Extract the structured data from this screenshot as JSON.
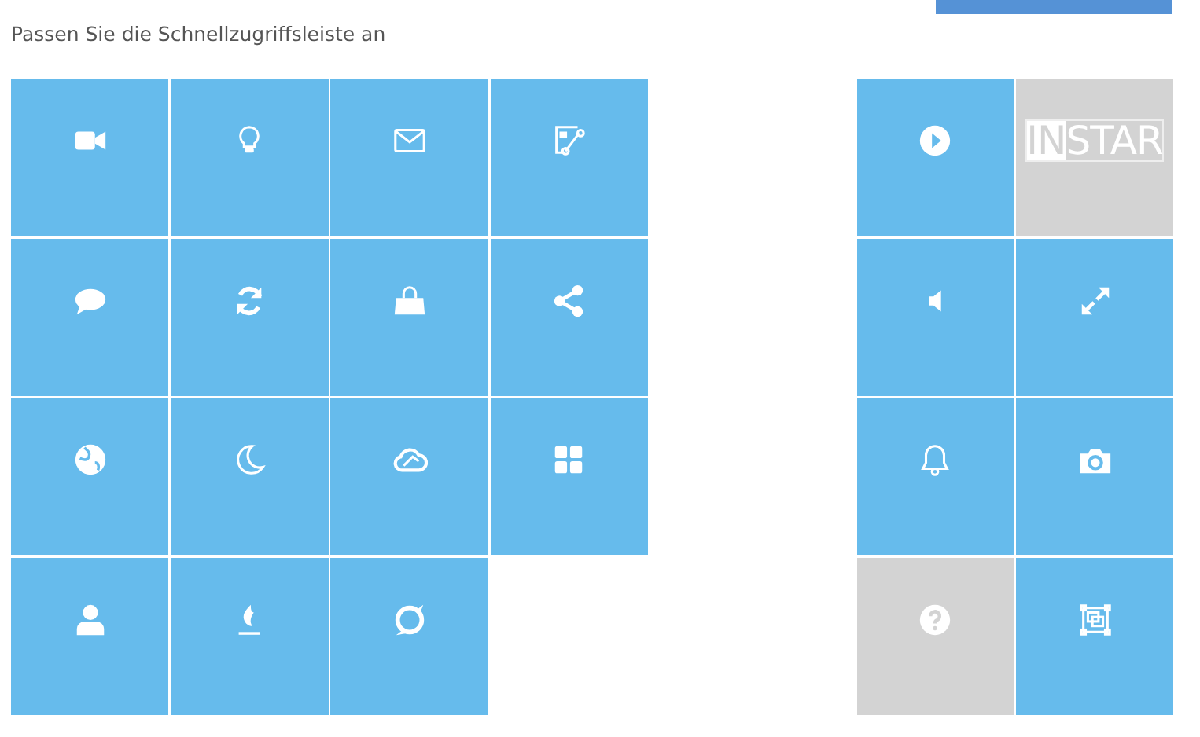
{
  "heading": "Passen Sie die Schnellzugriffsleiste an",
  "left_tiles": [
    {
      "disabled": false
    },
    {
      "disabled": false
    },
    {
      "disabled": false
    },
    {
      "disabled": false
    },
    {
      "disabled": false
    },
    {
      "disabled": false
    },
    {
      "disabled": false
    },
    {
      "disabled": false
    },
    {
      "disabled": false
    },
    {
      "disabled": false
    },
    {
      "disabled": false
    },
    {
      "disabled": false
    },
    {
      "disabled": false
    },
    {
      "disabled": false
    },
    {
      "disabled": false
    }
  ],
  "right_tiles": [
    {
      "disabled": false
    },
    {
      "disabled": true,
      "logo": [
        "IN",
        "STAR"
      ]
    },
    {
      "disabled": false
    },
    {
      "disabled": false
    },
    {
      "disabled": false
    },
    {
      "disabled": false
    },
    {
      "disabled": true
    },
    {
      "disabled": false
    }
  ]
}
